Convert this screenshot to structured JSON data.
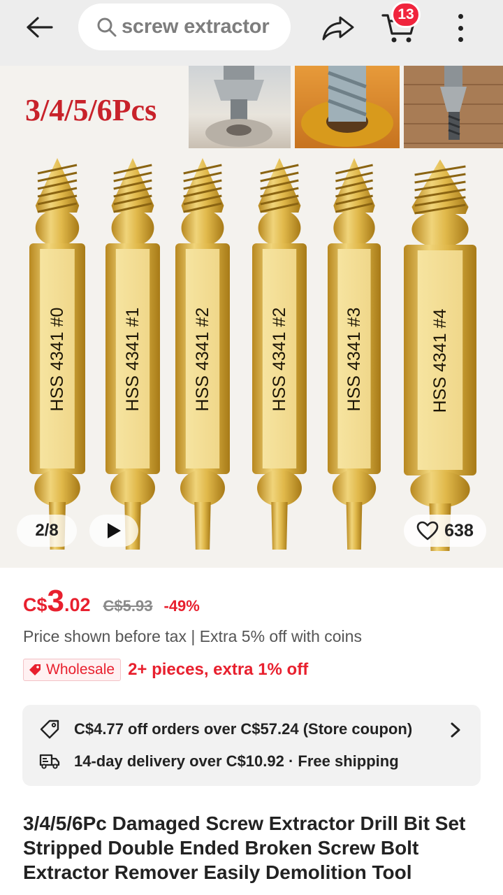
{
  "header": {
    "search_text": "screw extractor",
    "cart_count": "13",
    "icons": [
      "back-arrow-icon",
      "search-icon",
      "share-icon",
      "cart-icon",
      "more-icon"
    ]
  },
  "gallery": {
    "banner_label": "3/4/5/6Pcs",
    "bit_labels": [
      "HSS 4341 #0",
      "HSS 4341 #1",
      "HSS 4341 #2",
      "HSS 4341 #2",
      "HSS 4341 #3",
      "HSS 4341 #4"
    ],
    "image_counter": "2/8",
    "wishlist_count": "638"
  },
  "price": {
    "currency": "C$",
    "whole": "3",
    "cents": ".02",
    "original": "C$5.93",
    "discount": "-49%",
    "tax_note": "Price shown before tax | Extra 5% off with coins"
  },
  "wholesale": {
    "badge": "Wholesale",
    "text": "2+ pieces, extra 1% off"
  },
  "offers": {
    "coupon": "C$4.77 off orders over C$57.24 (Store coupon)",
    "delivery": "14-day delivery over C$10.92 · Free shipping"
  },
  "product": {
    "title": "3/4/5/6Pc Damaged Screw Extractor Drill Bit Set Stripped Double Ended Broken Screw Bolt Extractor Remover Easily Demolition Tool"
  },
  "colors": {
    "accent_red": "#e8202e",
    "badge_red": "#f0243d",
    "gold": "#d9b24a"
  }
}
